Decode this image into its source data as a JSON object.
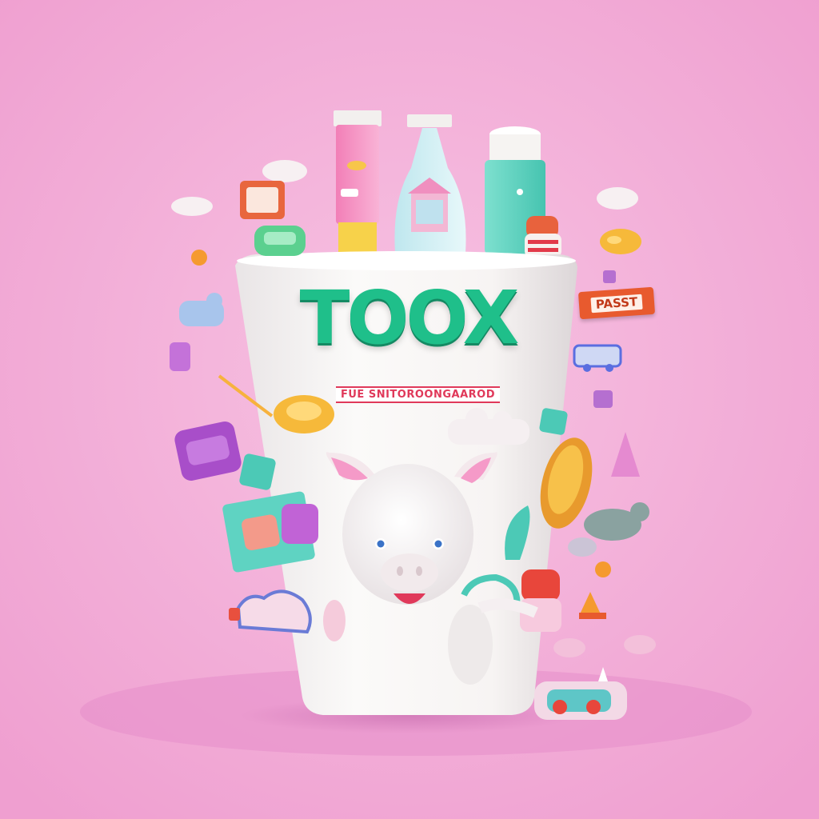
{
  "scene": {
    "background_color": "#f2b0d8",
    "cup_color": "#f6f4f2",
    "brand_color": "#1fbf8a",
    "accent_pink": "#f38fc0"
  },
  "cup": {
    "brand": "TOOX",
    "tagline": "FUE SNITOROONGAAROD"
  },
  "floating_sign": {
    "label": "PASST"
  }
}
